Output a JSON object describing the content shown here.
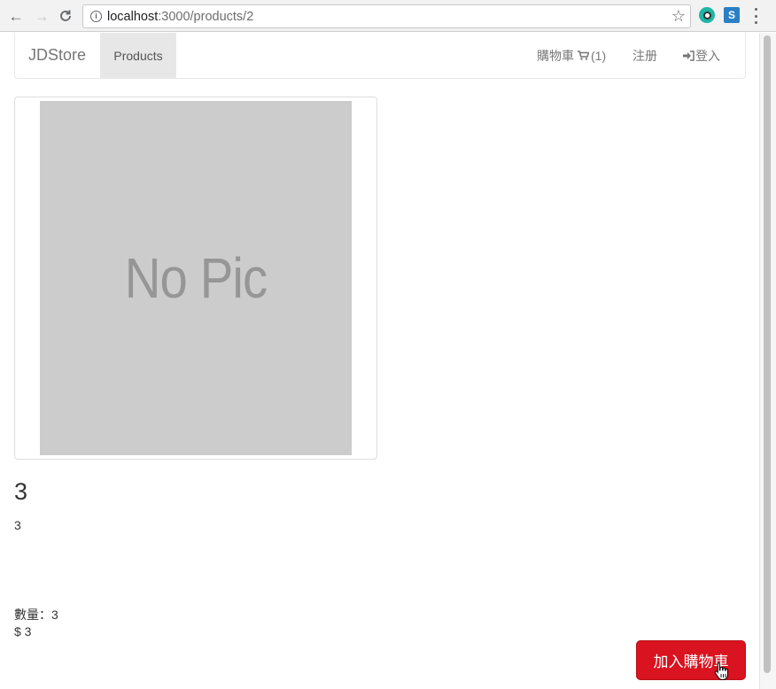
{
  "browser": {
    "url_host": "localhost",
    "url_path": ":3000/products/2"
  },
  "navbar": {
    "brand": "JDStore",
    "products_label": "Products",
    "cart_label": "購物車",
    "cart_count": "(1)",
    "register_label": "注册",
    "login_label": "登入"
  },
  "product": {
    "image_placeholder": "No Pic",
    "title": "3",
    "description": "3",
    "quantity_label": "數量：3",
    "price_label": "$ 3",
    "add_to_cart_label": "加入購物車"
  },
  "colors": {
    "primary_button": "#d9131f",
    "placeholder_bg": "#cccccc",
    "nav_active_bg": "#e7e7e7"
  },
  "icons": [
    "back-arrow-icon",
    "forward-arrow-icon",
    "reload-icon",
    "info-icon",
    "star-icon",
    "extension-icon",
    "menu-icon",
    "cart-icon",
    "login-icon",
    "hand-cursor-icon"
  ]
}
